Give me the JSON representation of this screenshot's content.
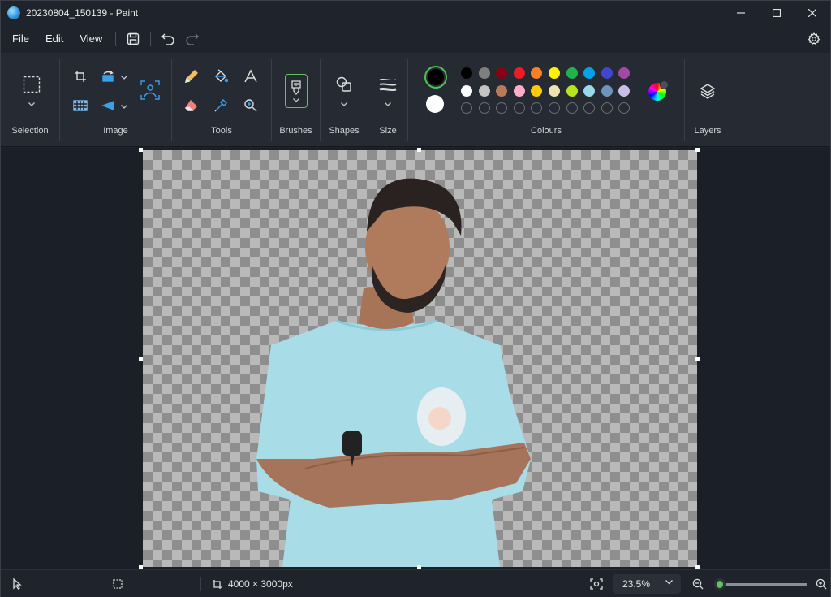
{
  "window": {
    "title": "20230804_150139 - Paint"
  },
  "menu": {
    "items": [
      "File",
      "Edit",
      "View"
    ]
  },
  "ribbon": {
    "groups": {
      "selection": "Selection",
      "image": "Image",
      "tools": "Tools",
      "brushes": "Brushes",
      "shapes": "Shapes",
      "size": "Size",
      "colours": "Colours",
      "layers": "Layers"
    },
    "colours": {
      "primary": "#000000",
      "secondary": "#ffffff",
      "row1": [
        "#000000",
        "#7f7f7f",
        "#880015",
        "#ed1c24",
        "#ff7f27",
        "#fff200",
        "#22b14c",
        "#00a2e8",
        "#3f48cc",
        "#a349a4"
      ],
      "row2": [
        "#ffffff",
        "#c3c3c3",
        "#b97a57",
        "#ffaec9",
        "#ffc90e",
        "#efe4b0",
        "#b5e61d",
        "#99d9ea",
        "#7092be",
        "#c8bfe7"
      ]
    }
  },
  "status": {
    "canvas_size": "4000 × 3000px",
    "zoom": "23.5%",
    "zoom_slider_fraction": 0.05
  }
}
